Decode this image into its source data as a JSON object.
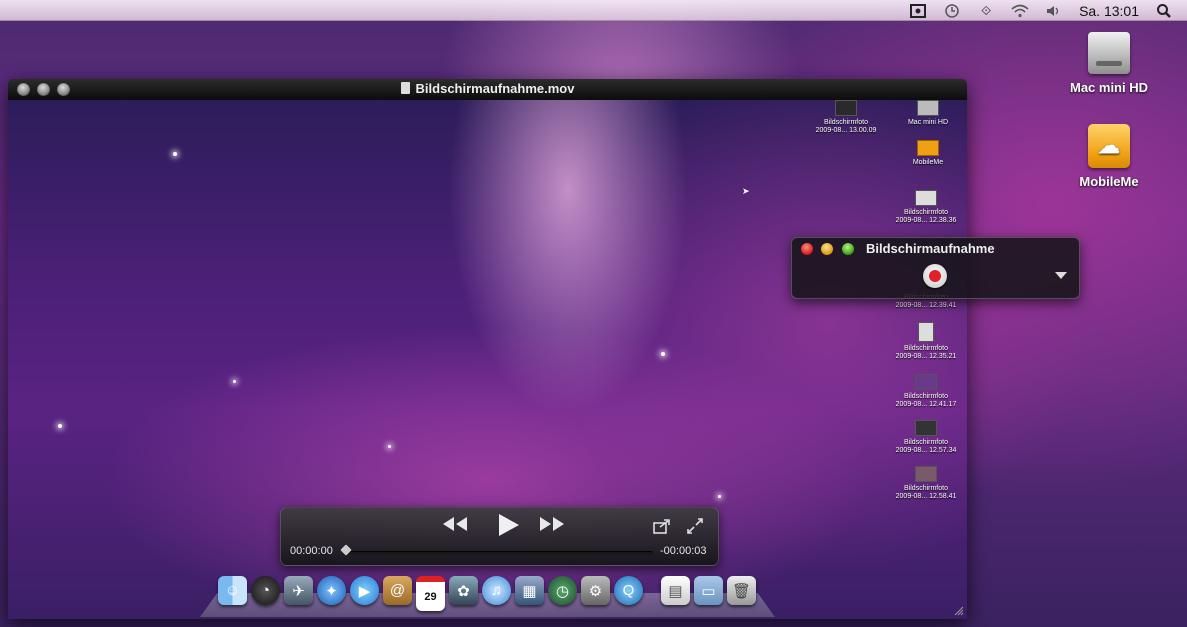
{
  "menubar": {
    "clock": "Sa. 13:01",
    "icons": [
      "screen-recording-icon",
      "time-machine-icon",
      "bluetooth-icon",
      "wifi-icon",
      "volume-icon",
      "spotlight-icon"
    ]
  },
  "desktop": {
    "icons": [
      {
        "label": "Mac mini HD",
        "icon": "hard-drive-icon"
      },
      {
        "label": "MobileMe",
        "icon": "mobileme-icon"
      }
    ]
  },
  "movie_window": {
    "title": "Bildschirmaufnahme.mov",
    "recorded_items": [
      {
        "name": "Bildschirmfoto",
        "detail": "2009-08... 13.00.09"
      },
      {
        "name": "Mac mini HD",
        "detail": ""
      },
      {
        "name": "MobileMe",
        "detail": ""
      },
      {
        "name": "Bildschirmfoto",
        "detail": "2009-08... 12.38.36"
      },
      {
        "name": "Bildschirmfoto",
        "detail": "2009-08... 12.39.41"
      },
      {
        "name": "Bildschirmfoto",
        "detail": "2009-08... 12.35.21"
      },
      {
        "name": "Bildschirmfoto",
        "detail": "2009-08... 12.41.17"
      },
      {
        "name": "Bildschirmfoto",
        "detail": "2009-08... 12.57.34"
      },
      {
        "name": "Bildschirmfoto",
        "detail": "2009-08... 12.58.41"
      }
    ]
  },
  "recording_panel": {
    "title": "Bildschirmaufnahme"
  },
  "controller": {
    "elapsed": "00:00:00",
    "remaining": "-00:00:03",
    "buttons": [
      "rewind",
      "play",
      "fast-forward",
      "share",
      "fullscreen"
    ]
  },
  "dock": {
    "items": [
      "finder",
      "dashboard",
      "mail",
      "safari",
      "ichat",
      "address-book",
      "ical",
      "iphoto",
      "itunes",
      "spaces",
      "time-machine",
      "system-preferences",
      "quicktime",
      "documents",
      "folder",
      "trash"
    ],
    "ical_date": "29"
  }
}
